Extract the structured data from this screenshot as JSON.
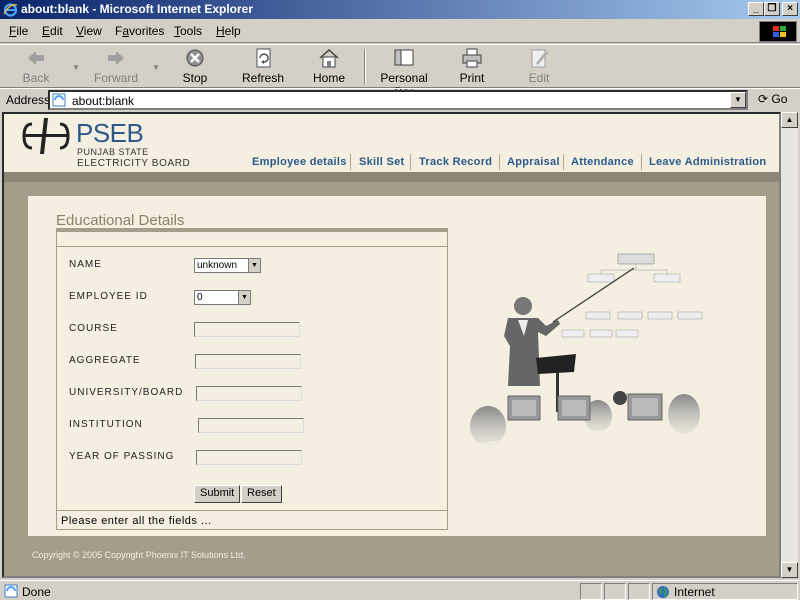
{
  "window": {
    "title": "about:blank - Microsoft Internet Explorer"
  },
  "menu": [
    {
      "label": "File",
      "key": "F",
      "rest": "ile"
    },
    {
      "label": "Edit",
      "key": "E",
      "rest": "dit"
    },
    {
      "label": "View",
      "key": "V",
      "rest": "iew"
    },
    {
      "label": "Favorites",
      "key": "a",
      "pre": "F",
      "rest": "vorites"
    },
    {
      "label": "Tools",
      "key": "T",
      "rest": "ools"
    },
    {
      "label": "Help",
      "key": "H",
      "rest": "elp"
    }
  ],
  "toolbar": {
    "back": "Back",
    "forward": "Forward",
    "stop": "Stop",
    "refresh": "Refresh",
    "home": "Home",
    "personal_bar": "Personal Bar",
    "print": "Print",
    "edit": "Edit"
  },
  "address": {
    "label": "Address",
    "url": "about:blank",
    "go": "Go"
  },
  "site": {
    "logo": "PSEB",
    "logo_line1": "PUNJAB STATE",
    "logo_line2": "ELECTRICITY BOARD",
    "nav": [
      "Employee details",
      "Skill Set",
      "Track Record",
      "Appraisal",
      "Attendance",
      "Leave Administration"
    ]
  },
  "form": {
    "section_title": "Educational Details",
    "labels": {
      "name": "NAME",
      "employee_id": "EMPLOYEE ID",
      "course": "COURSE",
      "aggregate": "AGGREGATE",
      "university": "UNIVERSITY/BOARD",
      "institution": "INSTITUTION",
      "year": "YEAR OF PASSING"
    },
    "name_value": "unknown",
    "employee_id_value": "0",
    "submit": "Submit",
    "reset": "Reset",
    "message": "Please enter all the fields ..."
  },
  "footer": {
    "copyright": "Copyright © 2005 Copyright  Phoenix IT Solutions Ltd."
  },
  "status": {
    "text": "Done",
    "zone": "Internet"
  }
}
